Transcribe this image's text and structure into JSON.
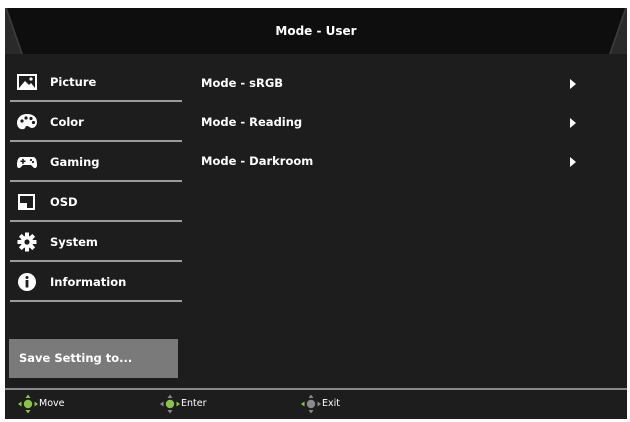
{
  "window": {
    "title": "Mode - User"
  },
  "sidebar": {
    "items": [
      {
        "label": "Picture",
        "icon": "picture-icon"
      },
      {
        "label": "Color",
        "icon": "palette-icon"
      },
      {
        "label": "Gaming",
        "icon": "gamepad-icon"
      },
      {
        "label": "OSD",
        "icon": "osd-icon"
      },
      {
        "label": "System",
        "icon": "gear-icon"
      },
      {
        "label": "Information",
        "icon": "info-icon"
      }
    ],
    "save_label": "Save Setting to..."
  },
  "main": {
    "options": [
      {
        "label": "Mode - sRGB",
        "icon": "chevron-right-icon"
      },
      {
        "label": "Mode - Reading",
        "icon": "chevron-right-icon"
      },
      {
        "label": "Mode - Darkroom",
        "icon": "chevron-right-icon"
      }
    ]
  },
  "footer": {
    "move_label": "Move",
    "enter_label": "Enter",
    "exit_label": "Exit"
  },
  "colors": {
    "background": "#1d1d1d",
    "header": "#0e0e0e",
    "selected": "#7a7a7a",
    "divider": "#9a9a9a",
    "joystick": "#8bc34a"
  }
}
